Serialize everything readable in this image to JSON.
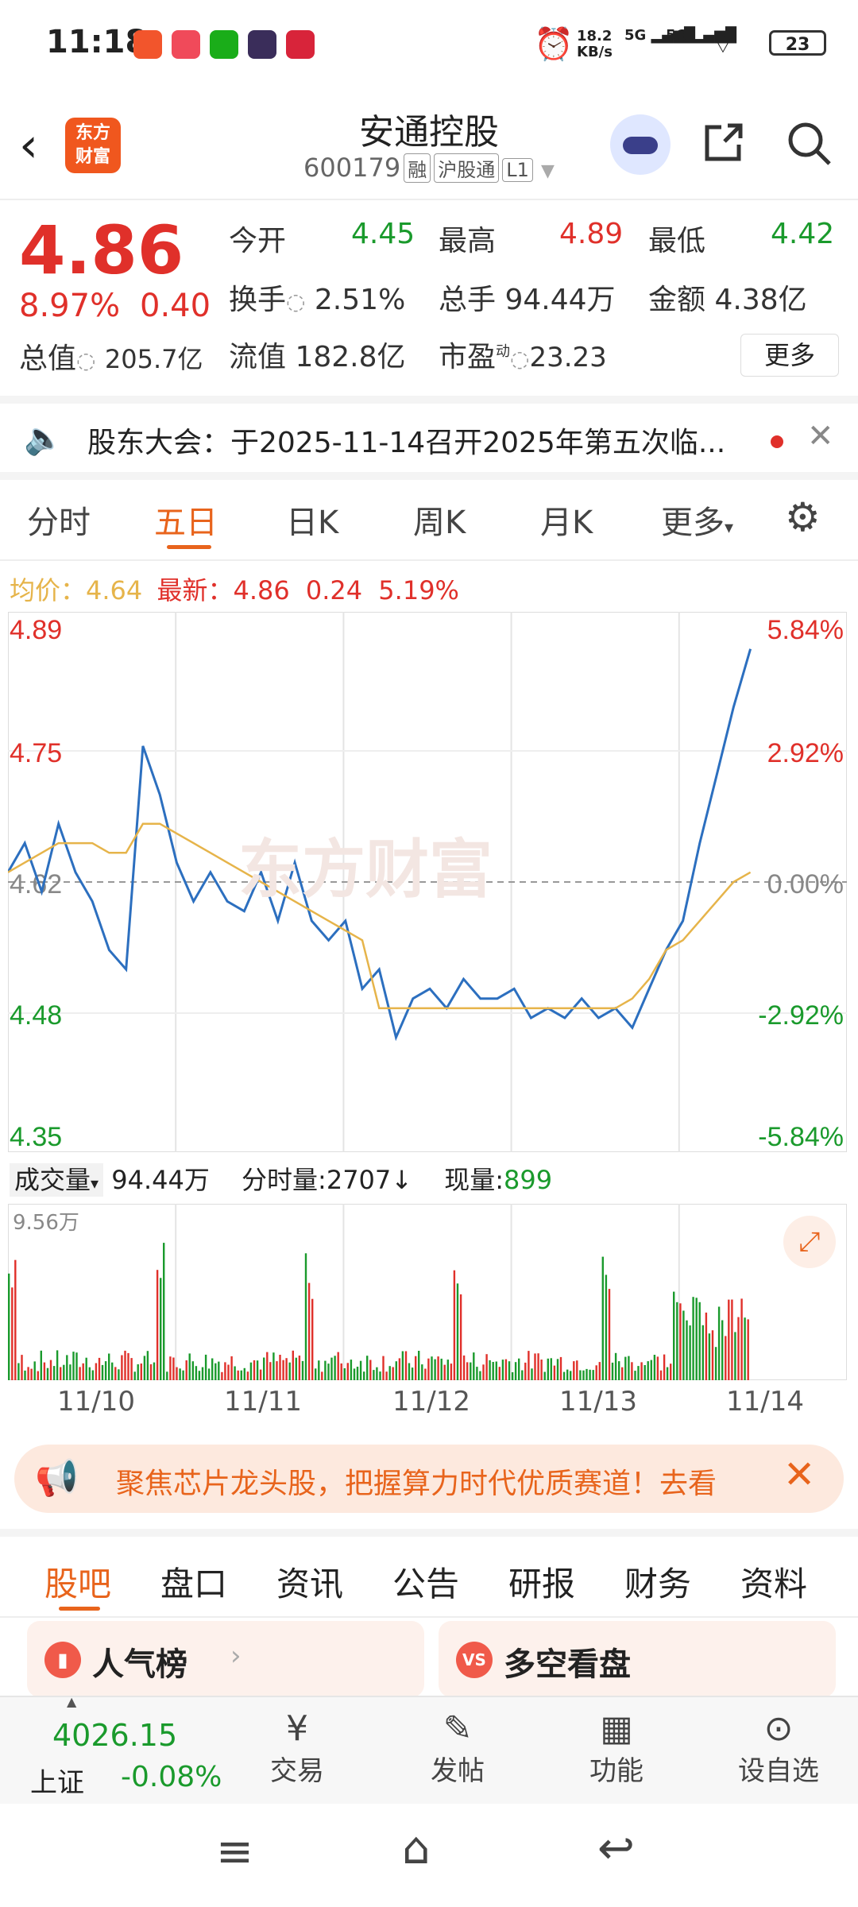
{
  "status": {
    "time": "11:18",
    "net_speed": "18.2\nKB/s",
    "net_speed_top": "18.2",
    "net_speed_bot": "KB/s",
    "sig1": "5G",
    "sig2": "5G",
    "battery": "23"
  },
  "header": {
    "title": "安通控股",
    "code": "600179",
    "tags": [
      "融",
      "沪股通",
      "L1"
    ],
    "logo_line1": "东方",
    "logo_line2": "财富"
  },
  "quote": {
    "price": "4.86",
    "pct": "8.97%",
    "chg": "0.40",
    "open_label": "今开",
    "open": "4.45",
    "high_label": "最高",
    "high": "4.89",
    "low_label": "最低",
    "low": "4.42",
    "turnover_label": "换手",
    "turnover": "2.51%",
    "volume_label": "总手",
    "volume": "94.44万",
    "amount_label": "金额",
    "amount": "4.38亿",
    "mktcap_label": "总值",
    "mktcap": "205.7亿",
    "float_label": "流值",
    "float": "182.8亿",
    "pe_label": "市盈",
    "pe_sup": "动",
    "pe": "23.23",
    "more": "更多"
  },
  "notice": {
    "text": "股东大会：于2025-11-14召开2025年第五次临..."
  },
  "tabs": [
    "分时",
    "五日",
    "日K",
    "周K",
    "月K",
    "更多"
  ],
  "chart_info": {
    "avg_label": "均价：",
    "avg": "4.64",
    "latest_label": "最新：",
    "latest": "4.86",
    "chg": "0.24",
    "pct": "5.19%"
  },
  "chart_data": {
    "type": "line",
    "x": [
      "11/10",
      "11/11",
      "11/12",
      "11/13",
      "11/14"
    ],
    "ylim": [
      4.35,
      4.89
    ],
    "left_ticks": [
      "4.89",
      "4.75",
      "4.62",
      "4.48",
      "4.35"
    ],
    "right_ticks": [
      "5.84%",
      "2.92%",
      "0.00%",
      "-2.92%",
      "-5.84%"
    ],
    "series": [
      {
        "values": [
          4.63,
          4.66,
          4.61,
          4.68,
          4.63,
          4.6,
          4.55,
          4.53,
          4.76,
          4.71,
          4.64,
          4.6,
          4.63,
          4.6,
          4.59,
          4.63,
          4.58,
          4.64,
          4.58,
          4.56,
          4.58,
          4.51,
          4.53,
          4.46,
          4.5,
          4.51,
          4.49,
          4.52,
          4.5,
          4.5,
          4.51,
          4.48,
          4.49,
          4.48,
          4.5,
          4.48,
          4.49,
          4.47,
          4.51,
          4.55,
          4.58,
          4.66,
          4.73,
          4.8,
          4.86
        ]
      },
      {
        "values": [
          4.63,
          4.64,
          4.65,
          4.66,
          4.66,
          4.66,
          4.65,
          4.65,
          4.68,
          4.68,
          4.67,
          4.66,
          4.65,
          4.64,
          4.63,
          4.62,
          4.61,
          4.6,
          4.59,
          4.58,
          4.57,
          4.56,
          4.49,
          4.49,
          4.49,
          4.49,
          4.49,
          4.49,
          4.49,
          4.49,
          4.49,
          4.49,
          4.49,
          4.49,
          4.49,
          4.49,
          4.49,
          4.5,
          4.52,
          4.55,
          4.56,
          4.58,
          4.6,
          4.62,
          4.63
        ]
      }
    ]
  },
  "volume_bar": {
    "label": "成交量",
    "total": "94.44万",
    "tick_label": "分时量:",
    "tick": "2707",
    "now_label": "现量:",
    "now": "899",
    "max": "9.56万"
  },
  "x_labels": [
    "11/10",
    "11/11",
    "11/12",
    "11/13",
    "11/14"
  ],
  "ad_banner": {
    "text": "聚焦芯片龙头股，把握算力时代优质赛道！去看"
  },
  "bottom_tabs": [
    "股吧",
    "盘口",
    "资讯",
    "公告",
    "研报",
    "财务",
    "资料"
  ],
  "cards": [
    {
      "label": "人气榜"
    },
    {
      "label": "多空看盘"
    }
  ],
  "index": {
    "value": "4026.15",
    "name": "上证",
    "pct": "-0.08%"
  },
  "nav": [
    "交易",
    "发帖",
    "功能",
    "设自选"
  ],
  "colors": {
    "up": "#e0302a",
    "down": "#1a9a2c",
    "accent": "#e8641c",
    "line": "#2c6fbf",
    "avg": "#e6b44a"
  }
}
